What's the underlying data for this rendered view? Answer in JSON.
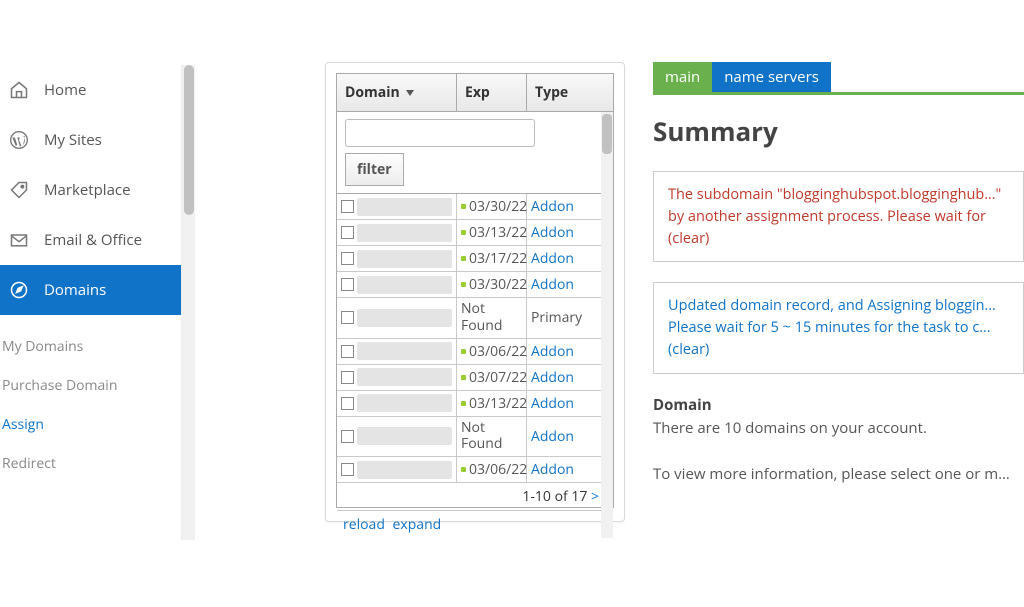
{
  "sidebar": {
    "items": [
      {
        "label": "Home",
        "icon": "home"
      },
      {
        "label": "My Sites",
        "icon": "wp"
      },
      {
        "label": "Marketplace",
        "icon": "tag"
      },
      {
        "label": "Email & Office",
        "icon": "envelope"
      },
      {
        "label": "Domains",
        "icon": "compass",
        "active": true
      }
    ],
    "sub": [
      {
        "label": "My Domains"
      },
      {
        "label": "Purchase Domain"
      },
      {
        "label": "Assign",
        "active": true
      },
      {
        "label": "Redirect"
      }
    ]
  },
  "table": {
    "headers": {
      "domain": "Domain",
      "exp": "Exp",
      "type": "Type"
    },
    "filter_button": "filter",
    "filter_value": "",
    "rows": [
      {
        "exp": "03/30/22",
        "type": "Addon",
        "dot": true,
        "not_found": false
      },
      {
        "exp": "03/13/22",
        "type": "Addon",
        "dot": true,
        "not_found": false
      },
      {
        "exp": "03/17/22",
        "type": "Addon",
        "dot": true,
        "not_found": false
      },
      {
        "exp": "03/30/22",
        "type": "Addon",
        "dot": true,
        "not_found": false
      },
      {
        "exp": "Not Found",
        "type": "Primary",
        "dot": false,
        "not_found": true
      },
      {
        "exp": "03/06/22",
        "type": "Addon",
        "dot": true,
        "not_found": false
      },
      {
        "exp": "03/07/22",
        "type": "Addon",
        "dot": true,
        "not_found": false
      },
      {
        "exp": "03/13/22",
        "type": "Addon",
        "dot": true,
        "not_found": false
      },
      {
        "exp": "Not Found",
        "type": "Addon",
        "dot": false,
        "not_found": true
      },
      {
        "exp": "03/06/22",
        "type": "Addon",
        "dot": true,
        "not_found": false
      }
    ],
    "pager": "1-10 of 17 ",
    "pager_next": ">",
    "actions": {
      "reload": "reload",
      "expand": "expand"
    }
  },
  "tabs": {
    "main": "main",
    "ns": "name servers"
  },
  "summary": {
    "title": "Summary",
    "error_msg": "The subdomain \"blogginghubspot.blogginghub…\" by another assignment process. Please wait for",
    "error_clear": "(clear)",
    "info_msg": "Updated domain record, and Assigning bloggin… Please wait for 5 ~ 15 minutes for the task to c…",
    "info_clear": "(clear)",
    "domain_label": "Domain",
    "domain_count": "There are 10 domains on your account.",
    "select_hint": "To view more information, please select one or m…"
  }
}
